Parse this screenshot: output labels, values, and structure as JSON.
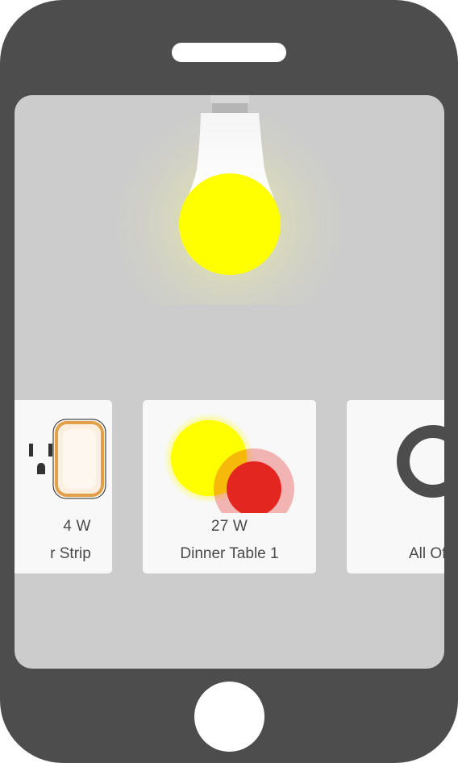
{
  "device": {
    "frame_color": "#4d4d4d",
    "screen_color": "#cccccc"
  },
  "hero": {
    "icon": "light-bulb-icon",
    "state": "on",
    "glow_color": "#ffff00"
  },
  "devices": [
    {
      "icon": "power-outlet-icon",
      "watts": "4 W",
      "name": "r Strip"
    },
    {
      "icon": "light-on-icon",
      "watts": "27 W",
      "name": "Dinner Table 1",
      "touch_indicator_color": "#e3261f"
    },
    {
      "icon": "power-off-icon",
      "watts": "",
      "name": "All Of"
    }
  ]
}
